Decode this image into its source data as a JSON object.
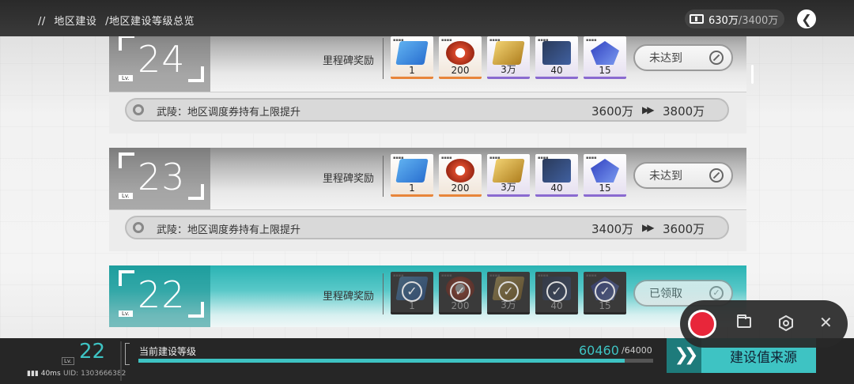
{
  "header": {
    "breadcrumb": [
      "//",
      "地区建设",
      "/地区建设等级总览"
    ],
    "currency_current": "630万",
    "currency_cap": "/3400万",
    "back_icon": "arrow-left-icon"
  },
  "levels": [
    {
      "level": "24",
      "lv_tag": "Lv.",
      "reward_label": "里程碑奖励",
      "items": [
        {
          "icon": "ticket-blue",
          "rarity": "orange",
          "qty": "1"
        },
        {
          "icon": "gear-red",
          "rarity": "orange",
          "qty": "200"
        },
        {
          "icon": "ticket-gold",
          "rarity": "purple",
          "qty": "3万"
        },
        {
          "icon": "chip-dark",
          "rarity": "purple",
          "qty": "40"
        },
        {
          "icon": "crystal-blue",
          "rarity": "purple",
          "qty": "15"
        }
      ],
      "status": "未达到",
      "bonus_text": "武陵：地区调度券持有上限提升",
      "bonus_from": "3600万",
      "bonus_to": "3800万"
    },
    {
      "level": "23",
      "lv_tag": "Lv.",
      "reward_label": "里程碑奖励",
      "items": [
        {
          "icon": "ticket-blue",
          "rarity": "orange",
          "qty": "1"
        },
        {
          "icon": "gear-red",
          "rarity": "orange",
          "qty": "200"
        },
        {
          "icon": "ticket-gold",
          "rarity": "purple",
          "qty": "3万"
        },
        {
          "icon": "chip-dark",
          "rarity": "purple",
          "qty": "40"
        },
        {
          "icon": "crystal-blue",
          "rarity": "purple",
          "qty": "15"
        }
      ],
      "status": "未达到",
      "bonus_text": "武陵：地区调度券持有上限提升",
      "bonus_from": "3400万",
      "bonus_to": "3600万"
    },
    {
      "level": "22",
      "lv_tag": "Lv.",
      "reward_label": "里程碑奖励",
      "items": [
        {
          "icon": "ticket-blue",
          "rarity": "claimed",
          "qty": "1"
        },
        {
          "icon": "gear-red",
          "rarity": "claimed",
          "qty": "200"
        },
        {
          "icon": "ticket-gold",
          "rarity": "claimed",
          "qty": "3万"
        },
        {
          "icon": "chip-dark",
          "rarity": "claimed",
          "qty": "40"
        },
        {
          "icon": "crystal-blue",
          "rarity": "claimed",
          "qty": "15"
        }
      ],
      "status": "已领取"
    }
  ],
  "arrows": "▶▶",
  "footer": {
    "level": "22",
    "lv_tag": "Lv.",
    "ping": "40ms",
    "uid": "UID: 1303666382",
    "title": "当前建设等级",
    "current": "60460",
    "max": "/64000",
    "progress": 0.9447,
    "source_button": "建设值来源"
  },
  "colors": {
    "accent": "#3ec3c3",
    "record": "#e8263a",
    "rarity_orange": "#e8853a",
    "rarity_purple": "#8a6ad0"
  }
}
